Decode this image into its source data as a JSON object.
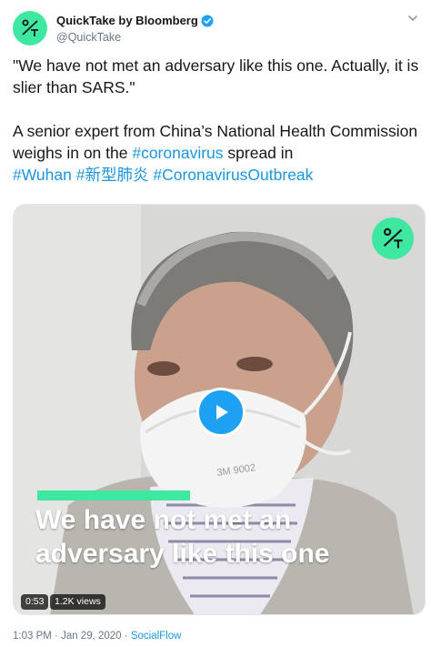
{
  "author": {
    "display_name": "QuickTake by Bloomberg",
    "handle": "@QuickTake",
    "avatar_glyph": "%T",
    "verified": true
  },
  "tweet": {
    "quote": "\"We have not met an adversary like this one. Actually, it is slier than SARS.\"",
    "body_prefix": "A senior expert from China’s National Health Commission weighs in on the ",
    "hashtag_coronavirus": "#coronavirus",
    "body_middle": " spread in ",
    "hashtag_wuhan": "#Wuhan",
    "hashtag_chinese": "#新型肺炎",
    "hashtag_outbreak": "#CoronavirusOutbreak"
  },
  "media": {
    "caption_line_1": "We have not met an",
    "caption_line_2": "adversary like this one",
    "duration": "0:53",
    "views": "1.2K views",
    "mask_text": "3M 9002"
  },
  "meta": {
    "time": "1:03 PM",
    "separator": " · ",
    "date": "Jan 29, 2020",
    "source": "SocialFlow"
  },
  "colors": {
    "accent_green": "#3ee8a0",
    "link_blue": "#1b95e0",
    "play_blue": "#1da1f2",
    "muted_gray": "#657786"
  }
}
